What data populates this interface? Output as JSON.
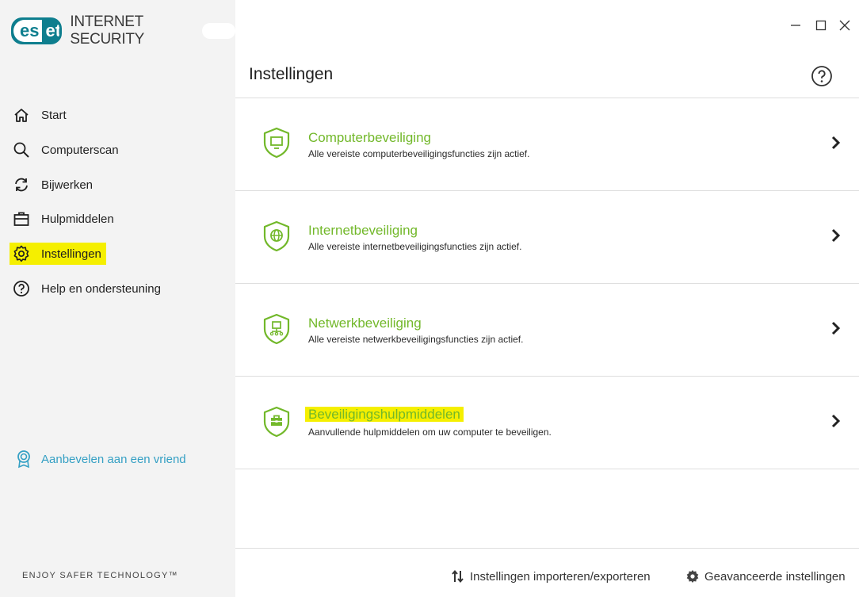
{
  "app": {
    "brand_left": "es",
    "brand_right": "et",
    "product": "INTERNET SECURITY"
  },
  "window": {
    "minimize": "—",
    "maximize": "☐",
    "close": "✕"
  },
  "sidebar": {
    "items": [
      {
        "label": "Start",
        "icon": "home-icon"
      },
      {
        "label": "Computerscan",
        "icon": "search-icon"
      },
      {
        "label": "Bijwerken",
        "icon": "refresh-icon"
      },
      {
        "label": "Hulpmiddelen",
        "icon": "toolbox-icon"
      },
      {
        "label": "Instellingen",
        "icon": "gear-icon",
        "active": true
      },
      {
        "label": "Help en ondersteuning",
        "icon": "help-icon"
      }
    ],
    "recommend": "Aanbevelen aan een vriend",
    "tagline": "ENJOY SAFER TECHNOLOGY™"
  },
  "main": {
    "title": "Instellingen",
    "sections": [
      {
        "title": "Computerbeveiliging",
        "desc": "Alle vereiste computerbeveiligingsfuncties zijn actief.",
        "icon": "computer-shield-icon"
      },
      {
        "title": "Internetbeveiliging",
        "desc": "Alle vereiste internetbeveiligingsfuncties zijn actief.",
        "icon": "globe-shield-icon"
      },
      {
        "title": "Netwerkbeveiliging",
        "desc": "Alle vereiste netwerkbeveiligingsfuncties zijn actief.",
        "icon": "network-shield-icon"
      },
      {
        "title": "Beveiligingshulpmiddelen",
        "desc": "Aanvullende hulpmiddelen om uw computer te beveiligen.",
        "icon": "toolbox-shield-icon",
        "highlighted": true
      }
    ]
  },
  "footer": {
    "import_export": "Instellingen importeren/exporteren",
    "advanced": "Geavanceerde instellingen"
  },
  "colors": {
    "accent_green": "#72b82a",
    "brand_teal": "#0e7e8e",
    "highlight": "#f5ef00",
    "link_blue": "#35a0c4"
  }
}
